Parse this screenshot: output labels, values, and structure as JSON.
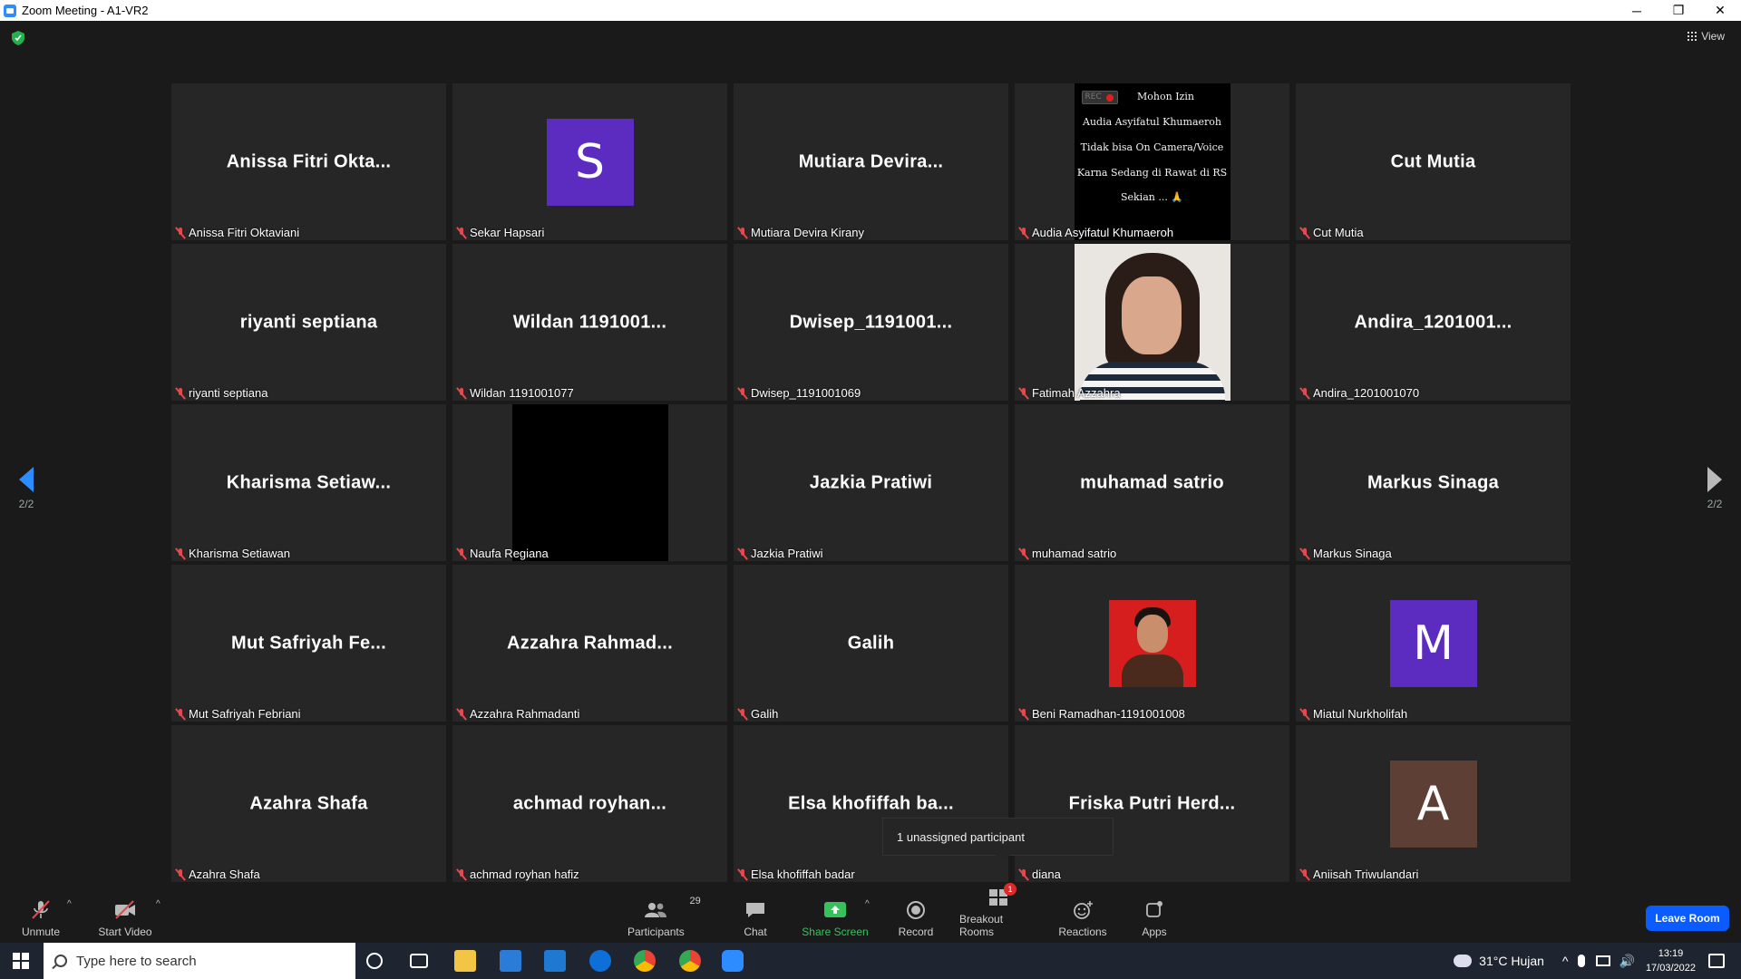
{
  "window": {
    "title": "Zoom Meeting - A1-VR2",
    "min": "─",
    "max": "❐",
    "close": "✕"
  },
  "meeting": {
    "view_label": "View",
    "page_left": "2/2",
    "page_right": "2/2",
    "tooltip": "1 unassigned participant"
  },
  "tiles": [
    {
      "big": "Anissa Fitri Okta...",
      "label": "Anissa Fitri Oktaviani",
      "kind": "name"
    },
    {
      "big": "S",
      "label": "Sekar Hapsari",
      "kind": "avatar",
      "color": "#5b2cbf"
    },
    {
      "big": "Mutiara Devira...",
      "label": "Mutiara Devira Kirany",
      "kind": "name"
    },
    {
      "big": "",
      "label": "Audia Asyifatul Khumaeroh",
      "kind": "notice",
      "rec": "REC",
      "lines": [
        "Mohon Izin",
        "Audia Asyifatul Khumaeroh",
        "Tidak bisa On Camera/Voice",
        "Karna Sedang di Rawat di RS",
        "Sekian ... 🙏"
      ]
    },
    {
      "big": "Cut Mutia",
      "label": "Cut Mutia",
      "kind": "name"
    },
    {
      "big": "riyanti septiana",
      "label": "riyanti septiana",
      "kind": "name"
    },
    {
      "big": "Wildan 1191001...",
      "label": "Wildan 1191001077",
      "kind": "name"
    },
    {
      "big": "Dwisep_1191001...",
      "label": "Dwisep_1191001069",
      "kind": "name"
    },
    {
      "big": "",
      "label": "Fatimah Azzahra",
      "kind": "video-girl"
    },
    {
      "big": "Andira_1201001...",
      "label": "Andira_1201001070",
      "kind": "name"
    },
    {
      "big": "Kharisma Setiaw...",
      "label": "Kharisma Setiawan",
      "kind": "name"
    },
    {
      "big": "",
      "label": "Naufa Regiana",
      "kind": "video-black"
    },
    {
      "big": "Jazkia Pratiwi",
      "label": "Jazkia Pratiwi",
      "kind": "name"
    },
    {
      "big": "muhamad satrio",
      "label": "muhamad satrio",
      "kind": "name"
    },
    {
      "big": "Markus Sinaga",
      "label": "Markus Sinaga",
      "kind": "name"
    },
    {
      "big": "Mut Safriyah Fe...",
      "label": "Mut Safriyah Febriani",
      "kind": "name"
    },
    {
      "big": "Azzahra Rahmad...",
      "label": "Azzahra Rahmadanti",
      "kind": "name"
    },
    {
      "big": "Galih",
      "label": "Galih",
      "kind": "name"
    },
    {
      "big": "",
      "label": "Beni Ramadhan-1191001008",
      "kind": "photo"
    },
    {
      "big": "M",
      "label": "Miatul Nurkholifah",
      "kind": "avatar",
      "color": "#5b2cbf"
    },
    {
      "big": "Azahra Shafa",
      "label": "Azahra Shafa",
      "kind": "name"
    },
    {
      "big": "achmad royhan...",
      "label": "achmad royhan hafiz",
      "kind": "name"
    },
    {
      "big": "Elsa khofiffah ba...",
      "label": "Elsa khofiffah badar",
      "kind": "name"
    },
    {
      "big": "Friska Putri Herd...",
      "label": "diana",
      "kind": "name"
    },
    {
      "big": "A",
      "label": "Aniisah Triwulandari",
      "kind": "avatar",
      "color": "#5e3f35"
    }
  ],
  "toolbar": {
    "unmute": "Unmute",
    "start_video": "Start Video",
    "participants": "Participants",
    "participants_count": "29",
    "chat": "Chat",
    "share_screen": "Share Screen",
    "record": "Record",
    "breakout_rooms": "Breakout Rooms",
    "breakout_badge": "1",
    "reactions": "Reactions",
    "apps": "Apps",
    "leave": "Leave Room"
  },
  "taskbar": {
    "search_placeholder": "Type here to search",
    "weather": "31°C  Hujan",
    "time": "13:19",
    "date": "17/03/2022"
  },
  "colors": {
    "accent_blue": "#0b5cff",
    "share_green": "#37c15c",
    "muted_red": "#e5484d"
  }
}
